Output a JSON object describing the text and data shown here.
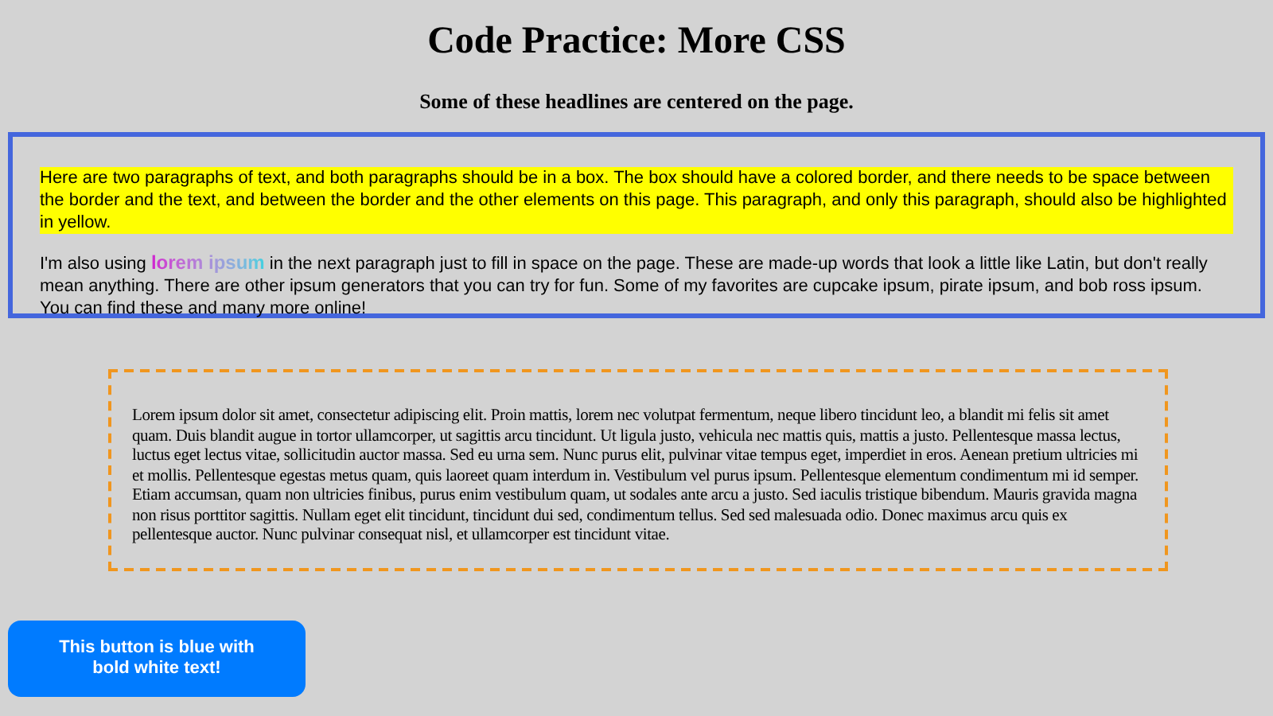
{
  "title": "Code Practice: More CSS",
  "subtitle": "Some of these headlines are centered on the page.",
  "blue_box": {
    "highlighted_paragraph": "Here are two paragraphs of text, and both paragraphs should be in a box. The box should have a colored border, and there needs to be space between the border and the text, and between the border and the other elements on this page. This paragraph, and only this paragraph, should also be highlighted in yellow.",
    "paragraph": {
      "before": "I'm also using ",
      "styled": "lorem ipsum",
      "after": " in the next paragraph just to fill in space on the page. These are made-up words that look a little like Latin, but don't really mean anything. There are other ipsum generators that you can try for fun. Some of my favorites are cupcake ipsum, pirate ipsum, and bob ross ipsum. You can find these and many more online!"
    }
  },
  "dashed_box": {
    "paragraph": "Lorem ipsum dolor sit amet, consectetur adipiscing elit. Proin mattis, lorem nec volutpat fermentum, neque libero tincidunt leo, a blandit mi felis sit amet quam. Duis blandit augue in tortor ullamcorper, ut sagittis arcu tincidunt. Ut ligula justo, vehicula nec mattis quis, mattis a justo. Pellentesque massa lectus, luctus eget lectus vitae, sollicitudin auctor massa. Sed eu urna sem. Nunc purus elit, pulvinar vitae tempus eget, imperdiet in eros. Aenean pretium ultricies mi et mollis. Pellentesque egestas metus quam, quis laoreet quam interdum in. Vestibulum vel purus ipsum. Pellentesque elementum condimentum mi id semper. Etiam accumsan, quam non ultricies finibus, purus enim vestibulum quam, ut sodales ante arcu a justo. Sed iaculis tristique bibendum. Mauris gravida magna non risus porttitor sagittis. Nullam eget elit tincidunt, tincidunt dui sed, condimentum tellus. Sed sed malesuada odio. Donec maximus arcu quis ex pellentesque auctor. Nunc pulvinar consequat nisl, et ullamcorper est tincidunt vitae."
  },
  "button": "This button is blue with bold white text!"
}
